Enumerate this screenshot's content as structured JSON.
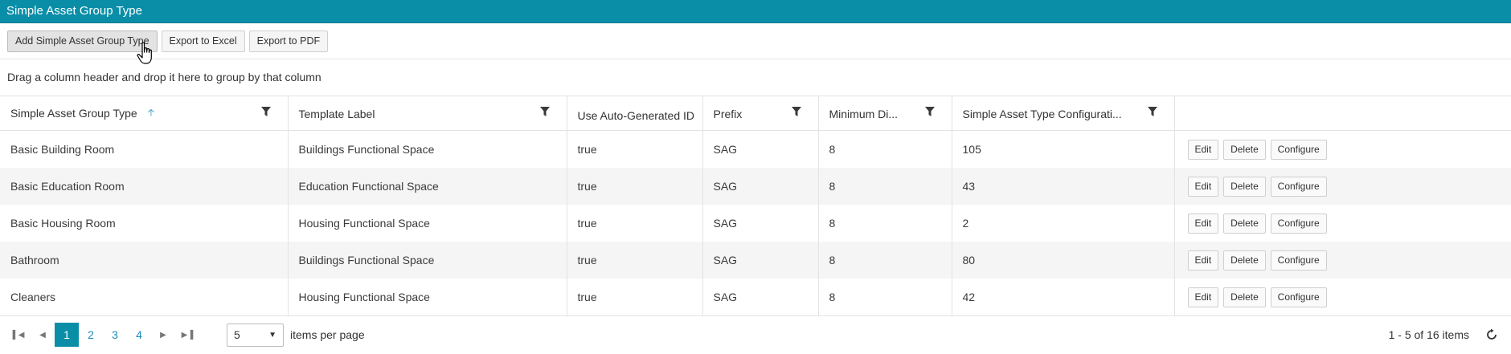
{
  "window": {
    "title": "Simple Asset Group Type"
  },
  "toolbar": {
    "add_label": "Add Simple Asset Group Type",
    "excel_label": "Export to Excel",
    "pdf_label": "Export to PDF"
  },
  "group_hint": "Drag a column header and drop it here to group by that column",
  "columns": [
    {
      "label": "Simple Asset Group Type",
      "sort": "ascending",
      "filter": true
    },
    {
      "label": "Template Label",
      "filter": true
    },
    {
      "label": "Use Auto-Generated ID",
      "filter": false
    },
    {
      "label": "Prefix",
      "filter": true
    },
    {
      "label": "Minimum Di...",
      "filter": true
    },
    {
      "label": "Simple Asset Type Configurati...",
      "filter": true
    },
    {
      "label": "",
      "filter": false
    }
  ],
  "rows": [
    {
      "type": "Basic Building Room",
      "template": "Buildings Functional Space",
      "auto_id": "true",
      "prefix": "SAG",
      "min": "8",
      "config": "105"
    },
    {
      "type": "Basic Education Room",
      "template": "Education Functional Space",
      "auto_id": "true",
      "prefix": "SAG",
      "min": "8",
      "config": "43"
    },
    {
      "type": "Basic Housing Room",
      "template": "Housing Functional Space",
      "auto_id": "true",
      "prefix": "SAG",
      "min": "8",
      "config": "2"
    },
    {
      "type": "Bathroom",
      "template": "Buildings Functional Space",
      "auto_id": "true",
      "prefix": "SAG",
      "min": "8",
      "config": "80"
    },
    {
      "type": "Cleaners",
      "template": "Housing Functional Space",
      "auto_id": "true",
      "prefix": "SAG",
      "min": "8",
      "config": "42"
    }
  ],
  "row_actions": {
    "edit": "Edit",
    "delete": "Delete",
    "configure": "Configure"
  },
  "pager": {
    "pages": [
      "1",
      "2",
      "3",
      "4"
    ],
    "current": "1",
    "page_size": "5",
    "items_per_page_label": "items per page",
    "info": "1 - 5 of 16 items"
  },
  "icons": {
    "sort": "arrow-up-icon",
    "filter": "filter-icon",
    "first": "first-page-icon",
    "prev": "prev-page-icon",
    "next": "next-page-icon",
    "last": "last-page-icon",
    "refresh": "refresh-icon",
    "cursor": "hand-cursor-icon"
  },
  "colors": {
    "accent": "#0a8ea8",
    "link": "#1a8cbb",
    "alt_row": "#f5f5f5"
  }
}
